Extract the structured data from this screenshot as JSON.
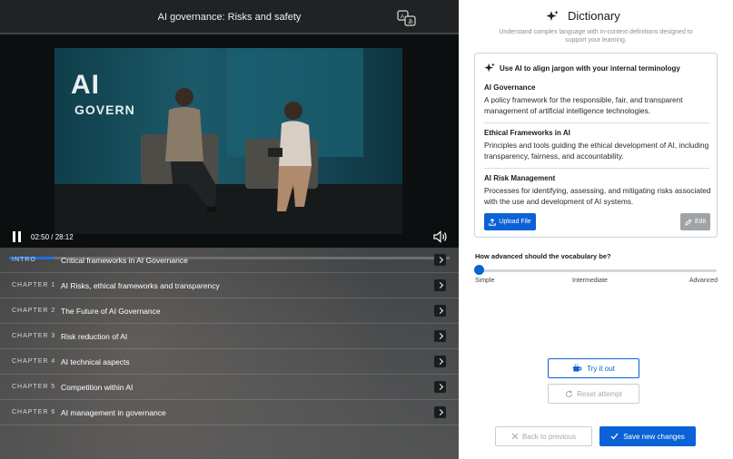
{
  "player": {
    "title": "AI governance: Risks and safety",
    "poster_text_1": "AI",
    "poster_text_2": "GOVERN",
    "time": "02:50 / 28:12",
    "progress": 0.1,
    "accent_color": "#1f6fe0"
  },
  "chapters": [
    {
      "code": "INTRO",
      "title": "Critical frameworks in AI Governance"
    },
    {
      "code": "CHAPTER 1",
      "title": "AI Risks, ethical frameworks and transparency"
    },
    {
      "code": "CHAPTER 2",
      "title": "The Future of AI Governance"
    },
    {
      "code": "CHAPTER 3",
      "title": "Risk reduction of AI"
    },
    {
      "code": "CHAPTER 4",
      "title": "AI technical aspects"
    },
    {
      "code": "CHAPTER 5",
      "title": "Competition within AI"
    },
    {
      "code": "CHAPTER 6",
      "title": "AI management in governance"
    }
  ],
  "dictionary": {
    "title": "Dictionary",
    "subtitle": "Understand complex language with in-context definitions designed to support your learning.",
    "card_heading": "Use AI to align jargon with your internal terminology",
    "terms": [
      {
        "name": "AI Governance",
        "definition": "A policy framework for the responsible, fair, and transparent management of artificial intelligence technologies."
      },
      {
        "name": "Ethical Frameworks in AI",
        "definition": "Principles and tools guiding the ethical development of AI, including transparency, fairness, and accountability."
      },
      {
        "name": "AI Risk Management",
        "definition": "Processes for identifying, assessing, and mitigating risks associated with the use and development of AI systems."
      }
    ],
    "upload_label": "Upload File",
    "edit_label": "Edit",
    "vocab_question": "How advanced should the vocabulary be?",
    "levels": {
      "simple": "Simple",
      "intermediate": "Intermediate",
      "advanced": "Advanced"
    },
    "selected_level": "Simple",
    "try_label": "Try it out",
    "reset_label": "Reset attempt",
    "back_label": "Back to previous",
    "save_label": "Save new changes",
    "primary_color": "#0b62d6"
  }
}
